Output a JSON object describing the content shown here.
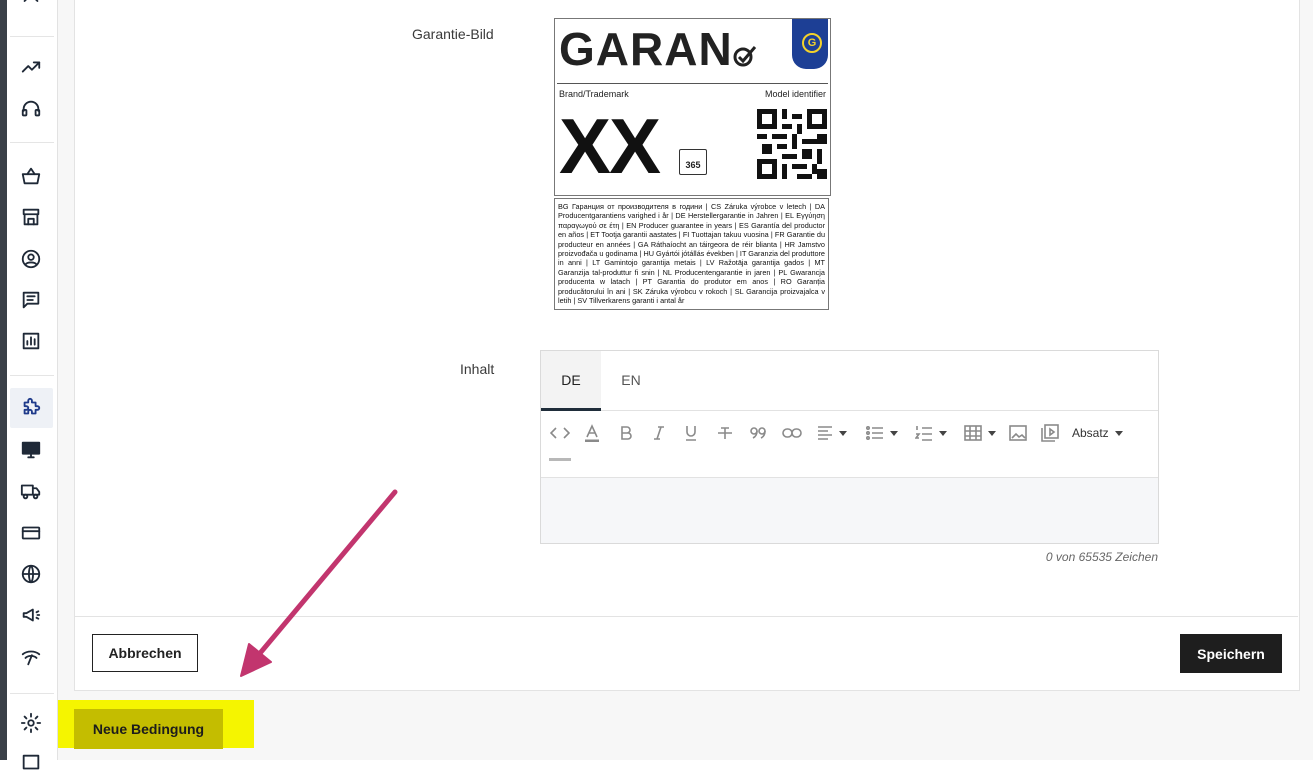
{
  "form": {
    "image_label": "Garantie-Bild",
    "content_label": "Inhalt"
  },
  "warranty_image": {
    "logo_text": "GARAN",
    "eu_badge_letter": "G",
    "brand_label": "Brand/Trademark",
    "model_label": "Model identifier",
    "brand_value": "XX",
    "calendar_days": "365",
    "languages_text": "BG Гаранция от производителя в години | CS Záruka výrobce v letech | DA Producentgarantiens varighed i år | DE Herstellergarantie in Jahren | EL Εγγύηση παραγωγού σε έτη | EN Producer guarantee in years | ES Garantía del productor en años | ET Tootja garantii aastates | FI Tuottajan takuu vuosina | FR Garantie du producteur en années | GA Ráthaíocht an táirgeora de réir blianta | HR Jamstvo proizvođača u godinama | HU Gyártói jótállás években | IT Garanzia del produttore in anni | LT Gamintojo garantija metais | LV Ražotāja garantija gados | MT Garanzija tal-produttur fi snin | NL Producentengarantie in jaren | PL Gwarancja producenta w latach | PT Garantia do produtor em anos | RO Garanția producătorului în ani | SK Záruka výrobcu v rokoch | SL Garancija proizvajalca v letih | SV Tillverkarens garanti i antal år"
  },
  "editor": {
    "tabs": [
      {
        "label": "DE",
        "active": true
      },
      {
        "label": "EN",
        "active": false
      }
    ],
    "toolbar_icons": [
      "code-icon",
      "text-color-icon",
      "bold-icon",
      "italic-icon",
      "underline-icon",
      "strikethrough-icon",
      "quote-icon",
      "link-icon",
      "align-icon",
      "bullet-list-icon",
      "numbered-list-icon",
      "table-icon",
      "image-icon",
      "video-icon",
      "horizontal-rule-icon"
    ],
    "paragraph_select": "Absatz",
    "counter": "0 von 65535 Zeichen"
  },
  "buttons": {
    "cancel": "Abbrechen",
    "save": "Speichern",
    "new_condition": "Neue Bedingung"
  },
  "colors": {
    "highlight": "#f5f500",
    "new_condition_bg": "#c4bd00",
    "save_bg": "#1e1e1e",
    "arrow": "#c2356e",
    "eu_blue": "#1d3f95"
  },
  "sidebar": {
    "icons": [
      "dashboard-icon",
      "trending-icon",
      "support-icon",
      "basket-icon",
      "store-icon",
      "customer-icon",
      "messages-icon",
      "reports-icon",
      "plugins-icon",
      "display-icon",
      "shipping-icon",
      "payment-icon",
      "globe-icon",
      "marketing-icon",
      "connectivity-icon",
      "settings-icon",
      "more-icon"
    ],
    "active": "plugins-icon"
  }
}
